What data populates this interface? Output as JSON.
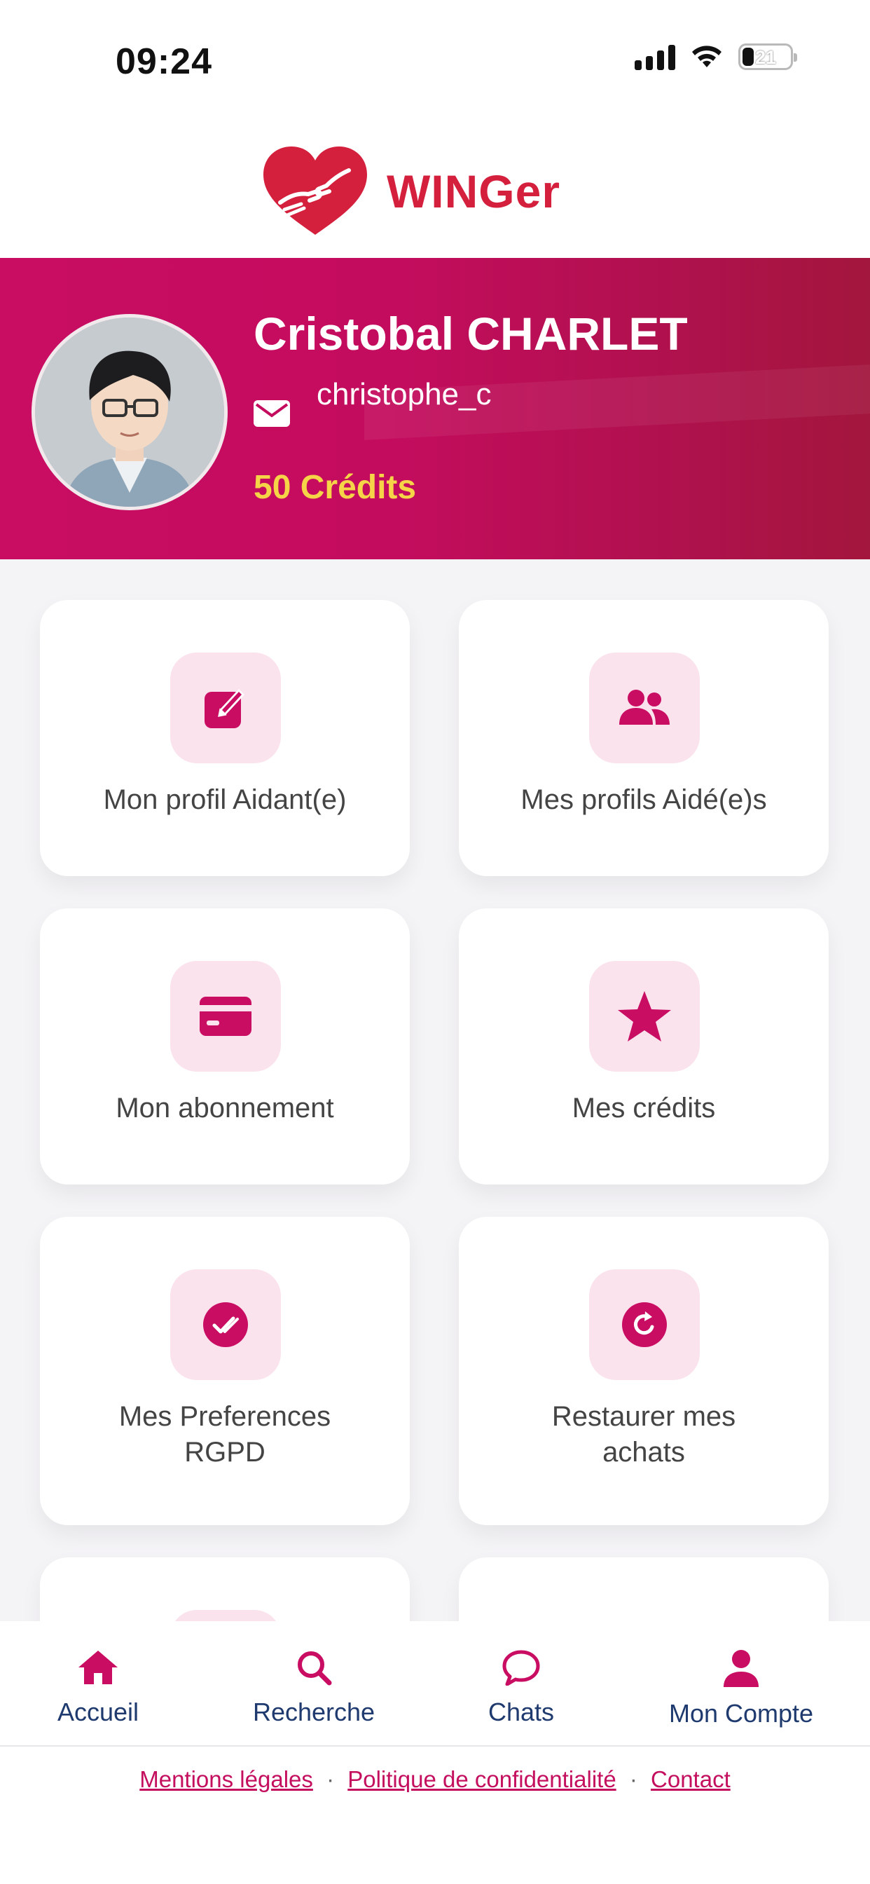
{
  "status": {
    "time": "09:24",
    "battery": "21"
  },
  "brand": {
    "name": "WINGer"
  },
  "profile": {
    "name": "Cristobal CHARLET",
    "login": "christophe_c",
    "credits": "50 Crédits"
  },
  "menu": [
    {
      "label": "Mon profil Aidant(e)",
      "icon": "edit-icon"
    },
    {
      "label": "Mes profils Aidé(e)s",
      "icon": "users-icon"
    },
    {
      "label": "Mon abonnement",
      "icon": "credit-card-icon"
    },
    {
      "label": "Mes crédits",
      "icon": "star-icon"
    },
    {
      "label": "Mes Preferences RGPD",
      "icon": "check-circle-icon"
    },
    {
      "label": "Restaurer mes achats",
      "icon": "refresh-icon"
    }
  ],
  "tabs": [
    {
      "label": "Accueil",
      "icon": "home-icon"
    },
    {
      "label": "Recherche",
      "icon": "search-icon"
    },
    {
      "label": "Chats",
      "icon": "chat-icon"
    },
    {
      "label": "Mon Compte",
      "icon": "user-icon"
    }
  ],
  "footer": {
    "legal": "Mentions légales",
    "privacy": "Politique de confidentialité",
    "contact": "Contact",
    "separator": "·"
  },
  "colors": {
    "brand": "#c80d62",
    "accent_soft": "#fbe3ee",
    "credits": "#f5d547",
    "nav_text": "#1f3a6e"
  }
}
